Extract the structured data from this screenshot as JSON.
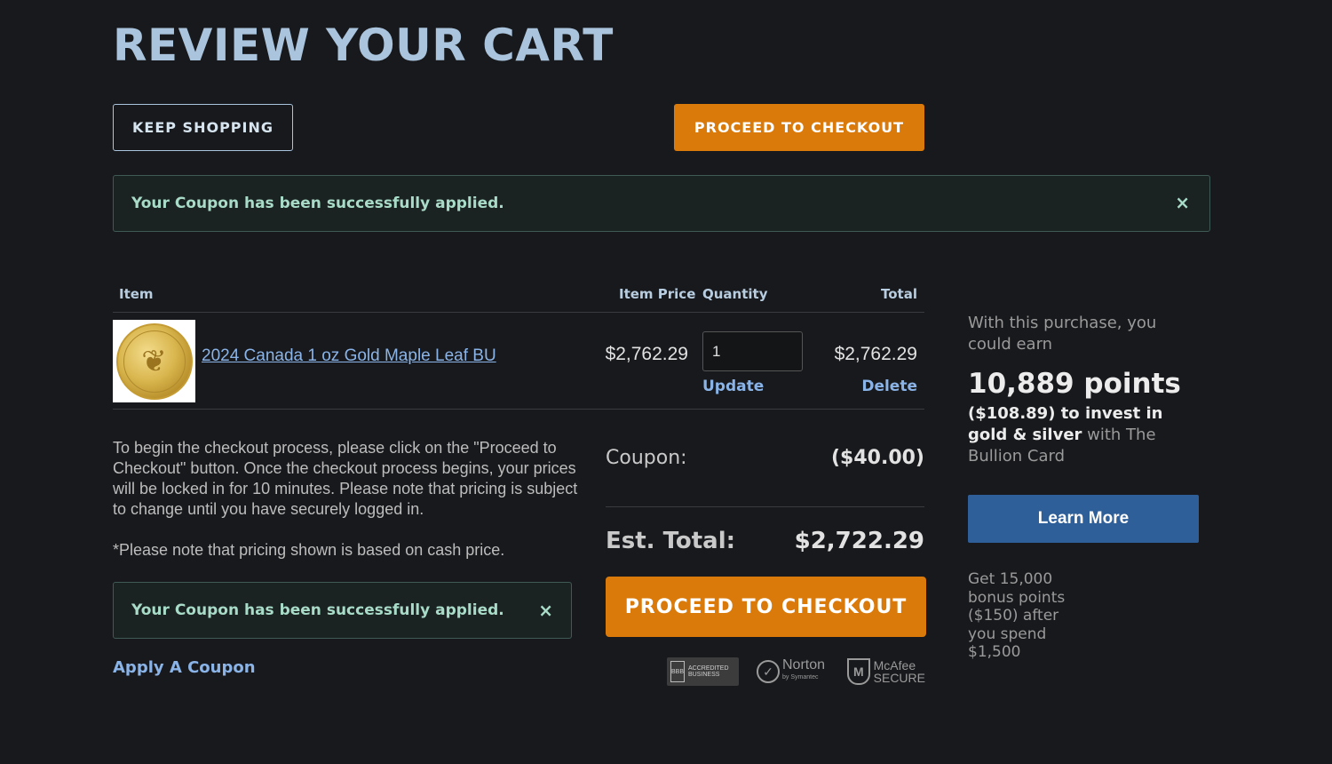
{
  "page": {
    "title": "REVIEW YOUR CART"
  },
  "top_buttons": {
    "keep_shopping": "KEEP SHOPPING",
    "proceed": "PROCEED TO CHECKOUT"
  },
  "alerts": {
    "top": {
      "message": "Your Coupon has been successfully applied.",
      "close": "×"
    },
    "bottom": {
      "message": "Your Coupon has been successfully applied.",
      "close": "×"
    }
  },
  "table": {
    "headers": {
      "item": "Item",
      "price": "Item Price",
      "quantity": "Quantity",
      "total": "Total"
    },
    "rows": [
      {
        "name": "2024 Canada 1 oz Gold Maple Leaf BU",
        "price": "$2,762.29",
        "quantity": "1",
        "total": "$2,762.29",
        "update": "Update",
        "delete": "Delete"
      }
    ]
  },
  "info": {
    "checkout_text": "To begin the checkout process, please click on the \"Proceed to Checkout\" button. Once the checkout process begins, your prices will be locked in for 10 minutes. Please note that pricing is subject to change until you have securely logged in.",
    "note": "*Please note that pricing shown is based on cash price.",
    "apply_coupon": "Apply A Coupon"
  },
  "summary": {
    "coupon_label": "Coupon:",
    "coupon_value": "($40.00)",
    "est_label": "Est. Total:",
    "est_value": "$2,722.29",
    "proceed": "PROCEED TO CHECKOUT"
  },
  "badges": {
    "bbb": {
      "mark": "BBB",
      "text": "ACCREDITED BUSINESS"
    },
    "norton": {
      "name": "Norton",
      "sub": "by Symantec"
    },
    "mcafee": {
      "mark": "M",
      "name": "McAfee",
      "sub": "SECURE"
    }
  },
  "sidebar": {
    "intro": "With this purchase, you could earn",
    "points": "10,889 points",
    "invest_bold": "($108.89) to invest in gold & silver",
    "invest_rest": " with The Bullion Card",
    "learn_more": "Learn More",
    "bonus": "Get 15,000 bonus points ($150) after you spend $1,500"
  }
}
